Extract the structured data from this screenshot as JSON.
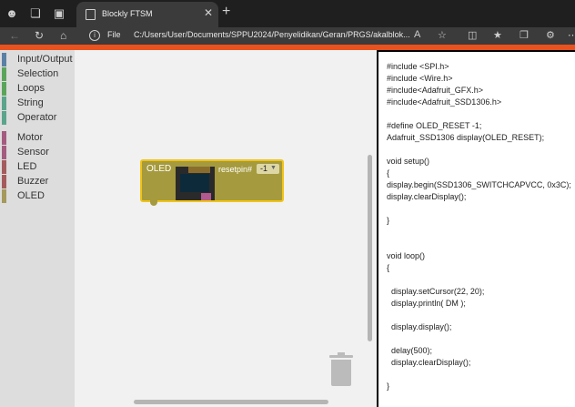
{
  "browser": {
    "tab_title": "Blockly FTSM",
    "url_prefix": "File",
    "url": "C:/Users/User/Documents/SPPU2024/Penyelidikan/Geran/PRGS/akalblok..."
  },
  "toolbox": {
    "categories": [
      {
        "label": "Input/Output",
        "color": "#5b80a5"
      },
      {
        "label": "Selection",
        "color": "#5ba55b"
      },
      {
        "label": "Loops",
        "color": "#5ba55b"
      },
      {
        "label": "String",
        "color": "#5ba58c"
      },
      {
        "label": "Operator",
        "color": "#5ba58c"
      },
      {
        "label": "Motor",
        "color": "#a55b80"
      },
      {
        "label": "Sensor",
        "color": "#a55b80"
      },
      {
        "label": "LED",
        "color": "#a55b5b"
      },
      {
        "label": "Buzzer",
        "color": "#a55b5b"
      },
      {
        "label": "OLED",
        "color": "#a5995b"
      }
    ]
  },
  "block": {
    "label": "OLED",
    "field_label": "resetpin#",
    "field_value": "-1"
  },
  "code": {
    "lines": [
      "#include <SPI.h>",
      "#include <Wire.h>",
      "#include<Adafruit_GFX.h>",
      "#include<Adafruit_SSD1306.h>",
      "",
      "#define OLED_RESET -1;",
      "Adafruit_SSD1306 display(OLED_RESET);",
      "",
      "void setup()",
      "{",
      "display.begin(SSD1306_SWITCHCAPVCC, 0x3C);",
      "display.clearDisplay();",
      "",
      "}",
      "",
      "",
      "void loop()",
      "{",
      "",
      "  display.setCursor(22, 20);",
      "  display.println( DM );",
      "",
      "  display.display();",
      "",
      "  delay(500);",
      "  display.clearDisplay();",
      "",
      "}"
    ]
  }
}
